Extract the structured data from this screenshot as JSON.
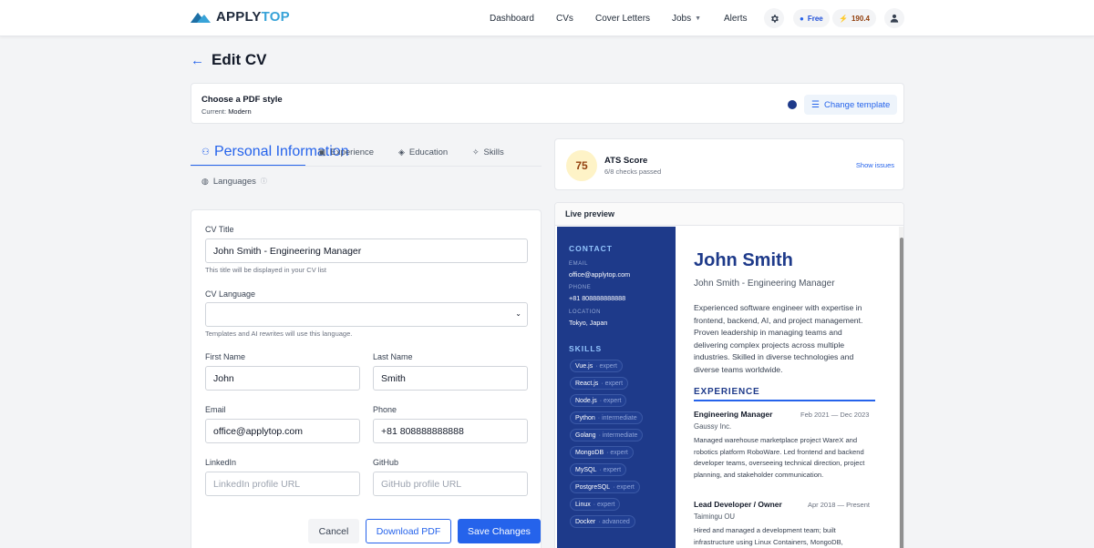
{
  "brand": {
    "part1": "APPLY",
    "part2": "TOP"
  },
  "nav": {
    "dashboard": "Dashboard",
    "cvs": "CVs",
    "cover_letters": "Cover Letters",
    "jobs": "Jobs",
    "alerts": "Alerts"
  },
  "plan": {
    "label": "Free",
    "credits": "190.4"
  },
  "page": {
    "title": "Edit CV"
  },
  "style": {
    "title": "Choose a PDF style",
    "current_label": "Current:",
    "current_value": "Modern",
    "change": "Change template"
  },
  "tabs": {
    "personal": "Personal Information",
    "experience": "Experience",
    "education": "Education",
    "skills": "Skills",
    "languages": "Languages"
  },
  "form": {
    "cv_title_label": "CV Title",
    "cv_title_value": "John Smith - Engineering Manager",
    "cv_title_hint": "This title will be displayed in your CV list",
    "cv_language_label": "CV Language",
    "cv_language_hint": "Templates and AI rewrites will use this language.",
    "first_name_label": "First Name",
    "first_name_value": "John",
    "last_name_label": "Last Name",
    "last_name_value": "Smith",
    "email_label": "Email",
    "email_value": "office@applytop.com",
    "phone_label": "Phone",
    "phone_value": "+81 808888888888",
    "linkedin_label": "LinkedIn",
    "linkedin_placeholder": "LinkedIn profile URL",
    "github_label": "GitHub",
    "github_placeholder": "GitHub profile URL"
  },
  "actions": {
    "cancel": "Cancel",
    "download": "Download PDF",
    "save": "Save Changes"
  },
  "ats": {
    "score": "75",
    "title": "ATS Score",
    "checks": "6/8 checks passed",
    "show": "Show issues"
  },
  "preview": {
    "header": "Live preview",
    "contact_h": "CONTACT",
    "email_k": "EMAIL",
    "email_v": "office@applytop.com",
    "phone_k": "PHONE",
    "phone_v": "+81 808888888888",
    "location_k": "LOCATION",
    "location_v": "Tokyo, Japan",
    "skills_h": "SKILLS",
    "skills": [
      {
        "name": "Vue.js",
        "level": "· expert"
      },
      {
        "name": "React.js",
        "level": "· expert"
      },
      {
        "name": "Node.js",
        "level": "· expert"
      },
      {
        "name": "Python",
        "level": "· intermediate"
      },
      {
        "name": "Golang",
        "level": "· intermediate"
      },
      {
        "name": "MongoDB",
        "level": "· expert"
      },
      {
        "name": "MySQL",
        "level": "· expert"
      },
      {
        "name": "PostgreSQL",
        "level": "· expert"
      },
      {
        "name": "Linux",
        "level": "· expert"
      },
      {
        "name": "Docker",
        "level": "· advanced"
      }
    ],
    "name": "John Smith",
    "role": "John Smith - Engineering Manager",
    "summary": "Experienced software engineer with expertise in frontend, backend, AI, and project management. Proven leadership in managing teams and delivering complex projects across multiple industries. Skilled in diverse technologies and diverse teams worldwide.",
    "experience_h": "EXPERIENCE",
    "jobs": [
      {
        "title": "Engineering Manager",
        "dates": "Feb 2021 — Dec 2023",
        "company": "Gaussy Inc.",
        "desc": "Managed warehouse marketplace project WareX and robotics platform RoboWare. Led frontend and backend developer teams, overseeing technical direction, project planning, and stakeholder communication."
      },
      {
        "title": "Lead Developer / Owner",
        "dates": "Apr 2018 — Present",
        "company": "Taimingu OU",
        "desc": "Hired and managed a development team; built infrastructure using Linux Containers, MongoDB,"
      }
    ]
  },
  "colors": {
    "accent": "#2563eb",
    "cv_sidebar": "#1e3a8a",
    "ats_badge": "#fef3c7"
  }
}
